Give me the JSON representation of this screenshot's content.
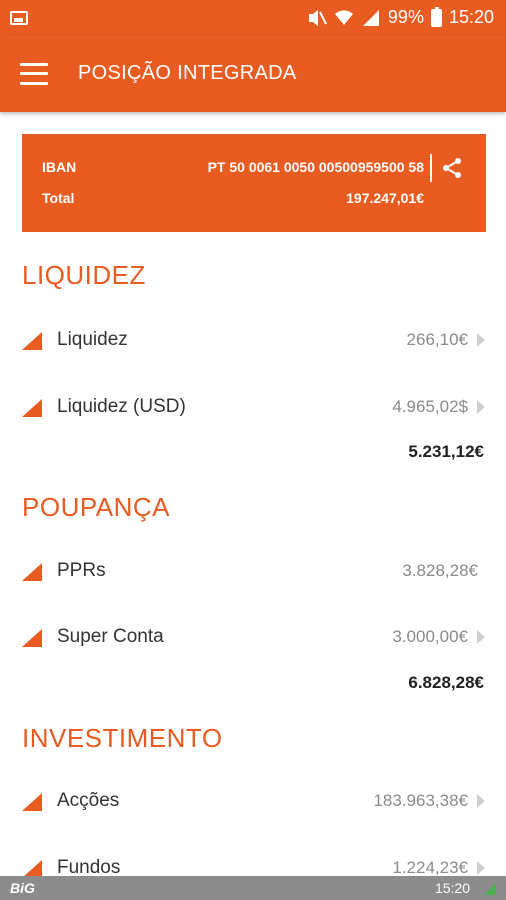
{
  "status_bar": {
    "battery": "99%",
    "time": "15:20",
    "icons": [
      "gallery-icon",
      "mute-icon",
      "wifi-icon",
      "signal-icon",
      "battery-icon"
    ]
  },
  "app_bar": {
    "title": "POSIÇÃO INTEGRADA",
    "menu_icon": "hamburger-menu-icon"
  },
  "account_card": {
    "iban_label": "IBAN",
    "iban_value": "PT 50 0061 0050 00500959500 58",
    "total_label": "Total",
    "total_value": "197.247,01€",
    "share_icon": "share-icon",
    "background": "#e85c21"
  },
  "sections": [
    {
      "title": "LIQUIDEZ",
      "items": [
        {
          "label": "Liquidez",
          "value": "266,10€",
          "has_arrow": true
        },
        {
          "label": "Liquidez (USD)",
          "value": "4.965,02$",
          "has_arrow": true
        }
      ],
      "subtotal": "5.231,12€"
    },
    {
      "title": "POUPANÇA",
      "items": [
        {
          "label": "PPRs",
          "value": "3.828,28€",
          "has_arrow": false
        },
        {
          "label": "Super Conta",
          "value": "3.000,00€",
          "has_arrow": true
        }
      ],
      "subtotal": "6.828,28€"
    },
    {
      "title": "INVESTIMENTO",
      "items": [
        {
          "label": "Acções",
          "value": "183.963,38€",
          "has_arrow": true
        },
        {
          "label": "Fundos",
          "value": "1.224,23€",
          "has_arrow": true
        }
      ]
    }
  ],
  "bottom_bar": {
    "brand": "BiG",
    "time": "15:20"
  },
  "colors": {
    "accent": "#e85c21",
    "value_text": "#8a8a8a",
    "label_text": "#333333"
  }
}
